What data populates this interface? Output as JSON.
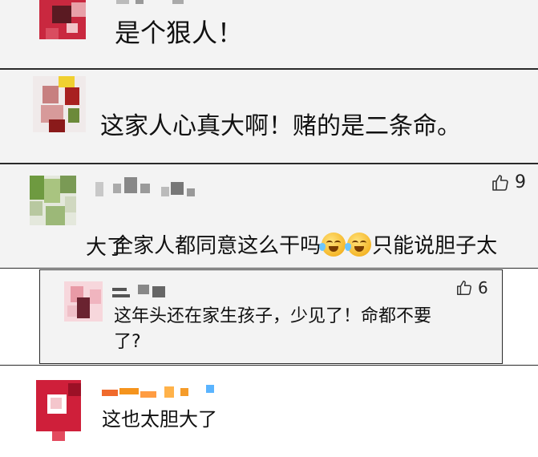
{
  "comments": [
    {
      "text": "是个狠人！"
    },
    {
      "text": "这家人心真大啊！赌的是二条命。"
    },
    {
      "text_part1": "全家人都同意这么干吗",
      "text_part2": "只能说胆子太",
      "text_line2": "大了",
      "likes": "9",
      "emoji": "crying-laughing-emoji"
    },
    {
      "text_line1": "这年头还在家生孩子，少见了！命都不要",
      "text_line2": "了?",
      "likes": "6"
    },
    {
      "text": "这也太胆大了"
    }
  ],
  "icons": {
    "like": "thumbs-up-icon"
  },
  "colors": {
    "panel": "#f3f3f3",
    "border": "#2a2a2a"
  }
}
